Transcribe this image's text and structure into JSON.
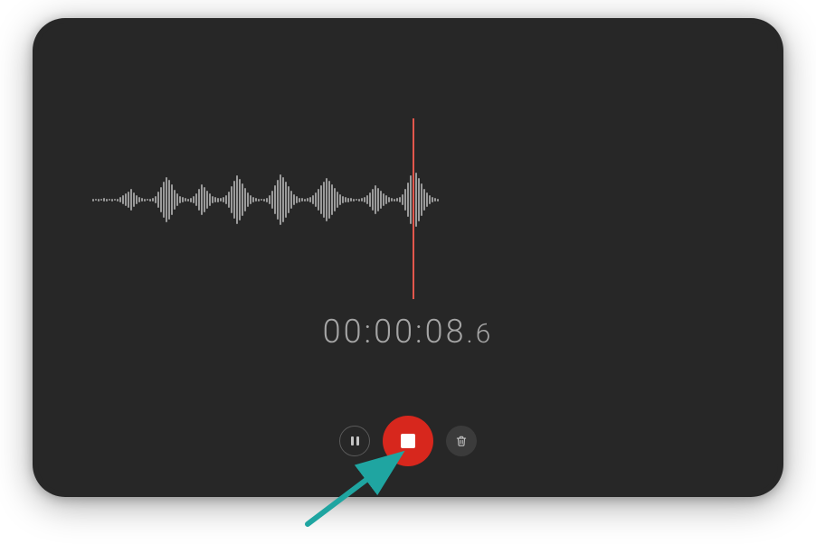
{
  "recorder": {
    "timer_main": "00:00:08",
    "timer_frac": ".6",
    "colors": {
      "playhead": "#e2574c",
      "record_button": "#d7271d",
      "background": "#272727",
      "annotation_arrow": "#1fa5a1"
    },
    "icons": {
      "pause": "pause-icon",
      "stop": "stop-icon",
      "delete": "trash-icon"
    },
    "waveform_amplitudes": [
      3,
      2,
      3,
      2,
      4,
      3,
      2,
      3,
      2,
      3,
      6,
      10,
      14,
      18,
      24,
      16,
      10,
      6,
      4,
      3,
      2,
      3,
      4,
      8,
      18,
      28,
      40,
      50,
      44,
      34,
      22,
      14,
      8,
      6,
      4,
      3,
      5,
      8,
      14,
      24,
      34,
      28,
      20,
      14,
      8,
      6,
      5,
      4,
      6,
      10,
      18,
      30,
      42,
      54,
      46,
      36,
      26,
      16,
      10,
      6,
      4,
      3,
      2,
      3,
      5,
      10,
      20,
      32,
      44,
      56,
      50,
      40,
      30,
      20,
      12,
      8,
      5,
      4,
      3,
      4,
      6,
      10,
      16,
      24,
      32,
      40,
      48,
      42,
      34,
      26,
      18,
      12,
      8,
      6,
      5,
      4,
      3,
      2,
      3,
      4,
      6,
      10,
      16,
      24,
      32,
      26,
      20,
      14,
      10,
      6,
      4,
      3,
      4,
      6,
      12,
      24,
      38,
      54,
      68,
      60,
      48,
      36,
      24,
      16,
      10,
      6,
      4,
      3
    ]
  }
}
